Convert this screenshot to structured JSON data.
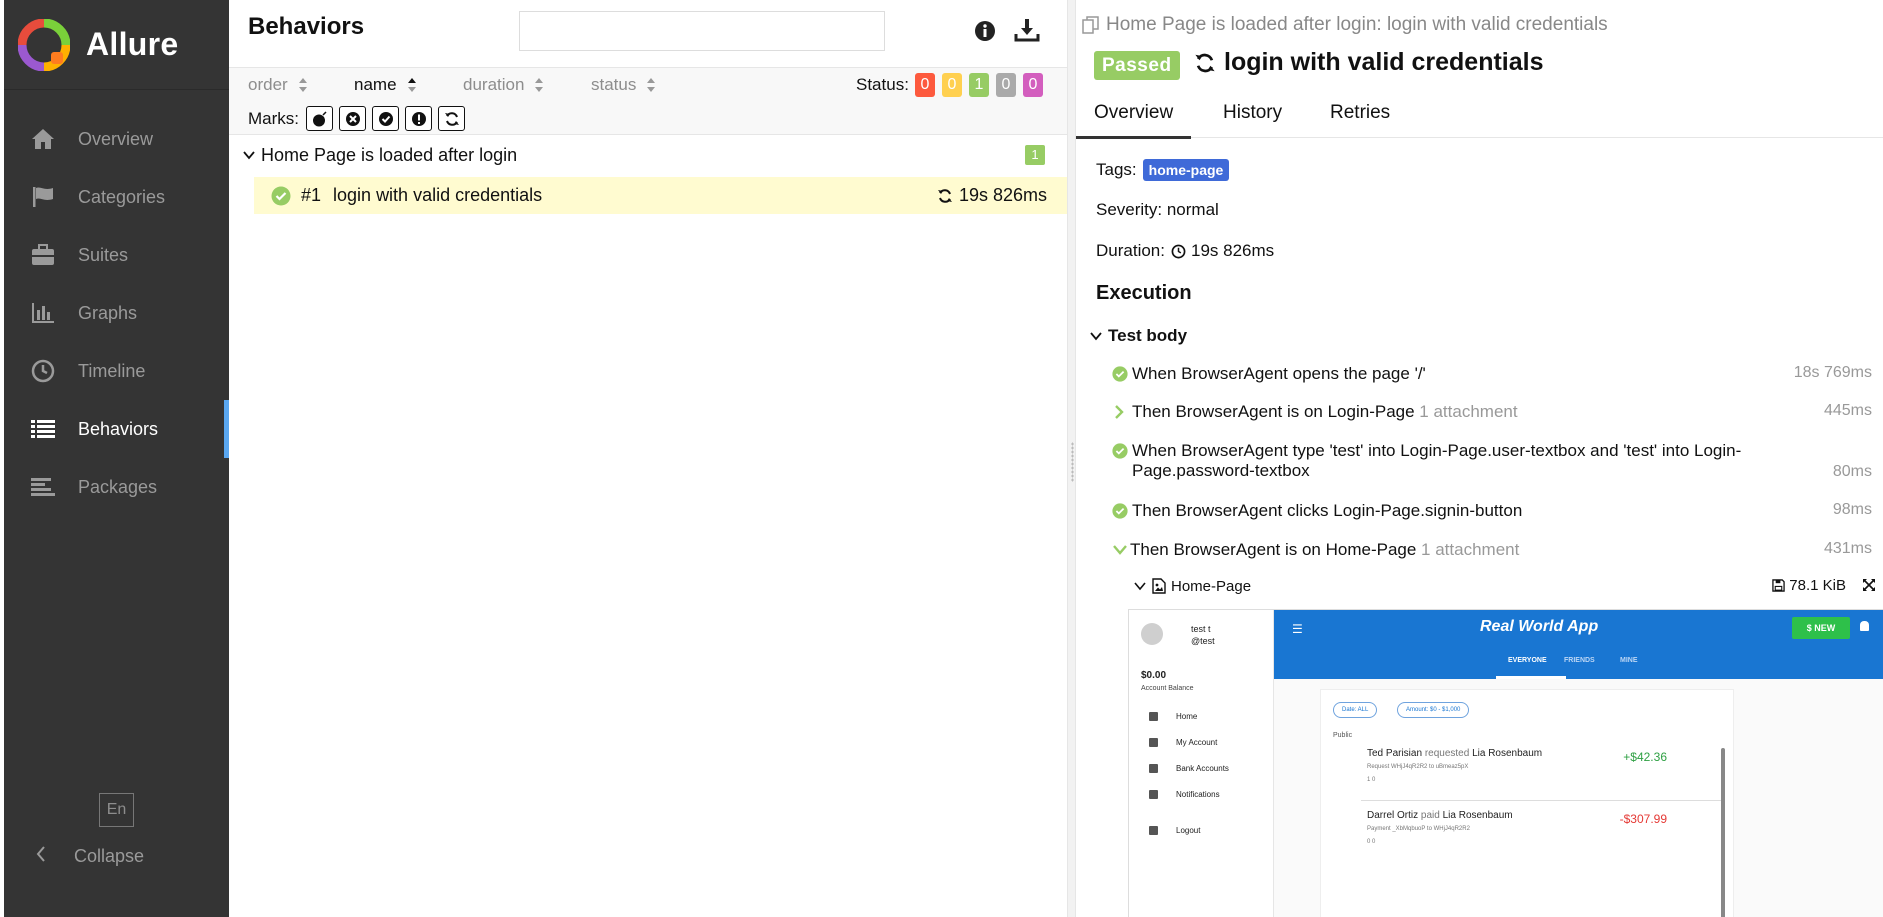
{
  "app": {
    "name": "Allure"
  },
  "sidebar": {
    "items": [
      {
        "label": "Overview"
      },
      {
        "label": "Categories"
      },
      {
        "label": "Suites"
      },
      {
        "label": "Graphs"
      },
      {
        "label": "Timeline"
      },
      {
        "label": "Behaviors",
        "active": true
      },
      {
        "label": "Packages"
      }
    ],
    "language": "En",
    "collapse_label": "Collapse"
  },
  "behaviors": {
    "title": "Behaviors",
    "search": {
      "value": "",
      "placeholder": ""
    },
    "sort": {
      "order": "order",
      "name": "name",
      "duration": "duration",
      "status": "status"
    },
    "status_label": "Status:",
    "status_counts": [
      {
        "count": "0",
        "color": "#fd5a3e"
      },
      {
        "count": "0",
        "color": "#ffd050"
      },
      {
        "count": "1",
        "color": "#97cc64"
      },
      {
        "count": "0",
        "color": "#aaaaaa"
      },
      {
        "count": "0",
        "color": "#d35ebe"
      }
    ],
    "marks_label": "Marks:",
    "group": {
      "name": "Home Page is loaded after login",
      "count": "1"
    },
    "test": {
      "num": "#1",
      "name": "login with valid credentials",
      "duration": "19s 826ms"
    }
  },
  "detail": {
    "breadcrumb": "Home Page is loaded after login: login with valid credentials",
    "status": "Passed",
    "title": "login with valid credentials",
    "tabs": [
      "Overview",
      "History",
      "Retries"
    ],
    "tags_label": "Tags:",
    "tag": "home-page",
    "severity": "Severity: normal",
    "duration_label": "Duration:",
    "duration": "19s 826ms",
    "execution": "Execution",
    "test_body": "Test body",
    "steps": [
      {
        "text": "When BrowserAgent opens the page '/'",
        "attachment": "",
        "duration": "18s 769ms"
      },
      {
        "text": "Then BrowserAgent is on Login-Page",
        "attachment": "1 attachment",
        "duration": "445ms"
      },
      {
        "text": "When BrowserAgent type 'test' into Login-Page.user-textbox and 'test' into Login-Page.password-textbox",
        "attachment": "",
        "duration": "80ms"
      },
      {
        "text": "Then BrowserAgent clicks Login-Page.signin-button",
        "attachment": "",
        "duration": "98ms"
      },
      {
        "text": "Then BrowserAgent is on Home-Page",
        "attachment": "1 attachment",
        "duration": "431ms"
      }
    ],
    "attachment": {
      "name": "Home-Page",
      "size": "78.1 KiB"
    }
  },
  "screenshot": {
    "user_name": "test t",
    "user_handle": "@test",
    "balance": "$0.00",
    "balance_label": "Account Balance",
    "nav": [
      "Home",
      "My Account",
      "Bank Accounts",
      "Notifications",
      "Logout"
    ],
    "app_title": "Real World App",
    "new_button": "$ NEW",
    "tabs": [
      "EVERYONE",
      "FRIENDS",
      "MINE"
    ],
    "filter_date": "Date: ALL",
    "filter_amount": "Amount: $0 - $1,000",
    "public_label": "Public",
    "transactions": [
      {
        "from": "Ted Parisian",
        "verb": "requested",
        "to": "Lia Rosenbaum",
        "sub": "Request  WHjJ4qR2R2 to uBmeaz5pX",
        "meta": "1   0",
        "amount": "+$42.36",
        "color": "#2ea043"
      },
      {
        "from": "Darrel Ortiz",
        "verb": "paid",
        "to": "Lia Rosenbaum",
        "sub": "Payment  _XbMqbuoP to WHjJ4qR2R2",
        "meta": "0   0",
        "amount": "-$307.99",
        "color": "#e53935"
      }
    ]
  }
}
